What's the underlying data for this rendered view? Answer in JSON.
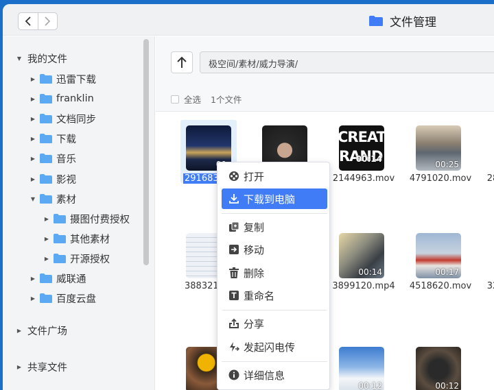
{
  "window": {
    "title": "文件管理"
  },
  "colors": {
    "accent": "#3f7cf6",
    "folder": "#5aa9f2",
    "background": "#1c6fc8"
  },
  "sidebar": {
    "root_label": "我的文件",
    "items": [
      {
        "label": "迅雷下载"
      },
      {
        "label": "franklin"
      },
      {
        "label": "文档同步"
      },
      {
        "label": "下载"
      },
      {
        "label": "音乐"
      },
      {
        "label": "影视"
      },
      {
        "label": "素材",
        "expanded": true,
        "children": [
          {
            "label": "摄图付费授权"
          },
          {
            "label": "其他素材"
          },
          {
            "label": "开源授权"
          }
        ]
      },
      {
        "label": "威联通"
      },
      {
        "label": "百度云盘"
      }
    ],
    "sections": [
      {
        "label": "文件广场"
      },
      {
        "label": "共享文件"
      }
    ]
  },
  "toolbar": {
    "path": "极空间/素材/威力导演/",
    "select_all": "全选",
    "count": "1个文件"
  },
  "files": [
    {
      "name": "2916838",
      "duration": "00:",
      "selected": true
    },
    {
      "name": "",
      "duration": ""
    },
    {
      "name": "2144963.mov",
      "duration": "00:14"
    },
    {
      "name": "4791020.mov",
      "duration": "00:25"
    },
    {
      "name": "28",
      "duration": ""
    },
    {
      "name": "3883214",
      "duration": "0"
    },
    {
      "name": "",
      "duration": ""
    },
    {
      "name": "3899120.mp4",
      "duration": "00:14"
    },
    {
      "name": "4518620.mov",
      "duration": "00:17"
    },
    {
      "name": "32",
      "duration": ""
    },
    {
      "name": "",
      "duration": ""
    },
    {
      "name": "",
      "duration": ""
    },
    {
      "name": "",
      "duration": "00:12"
    },
    {
      "name": "",
      "duration": "00:12"
    }
  ],
  "context_menu": {
    "open": "打开",
    "download": "下载到电脑",
    "copy": "复制",
    "move": "移动",
    "delete": "删除",
    "rename": "重命名",
    "share": "分享",
    "flash_send": "发起闪电传",
    "details": "详细信息"
  }
}
